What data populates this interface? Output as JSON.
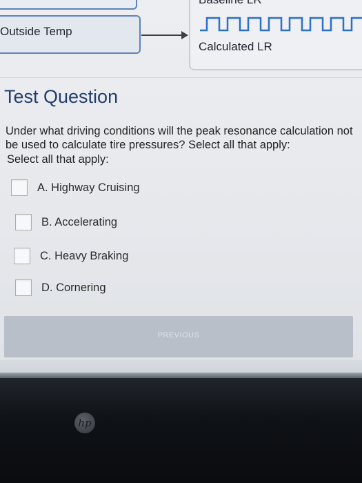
{
  "diagram": {
    "baseline_label": "Baseline LR",
    "outside_temp_label": "Outside Temp",
    "calculated_label": "Calculated LR"
  },
  "question": {
    "heading": "Test Question",
    "text": "Under what driving conditions will the peak resonance calculation not be used to calculate tire pressures? Select all that apply:",
    "instruction": "Select all that apply:",
    "options": [
      {
        "label": "A. Highway Cruising",
        "checked": false
      },
      {
        "label": "B. Accelerating",
        "checked": false
      },
      {
        "label": "C. Heavy Braking",
        "checked": false
      },
      {
        "label": "D. Cornering",
        "checked": false
      }
    ]
  },
  "navigation": {
    "previous_label": "PREVIOUS"
  },
  "device": {
    "logo_text": "hp"
  }
}
